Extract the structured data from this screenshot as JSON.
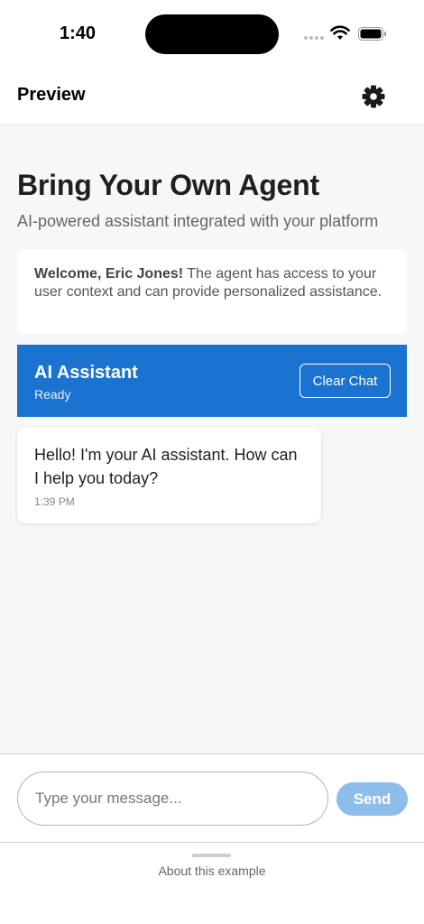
{
  "status_bar": {
    "time": "1:40",
    "icons": [
      "signal-icon",
      "wifi-icon",
      "battery-icon"
    ]
  },
  "header": {
    "title": "Preview",
    "settings_icon": "gear-icon"
  },
  "main": {
    "title": "Bring Your Own Agent",
    "subtitle": "AI-powered assistant integrated with your platform",
    "welcome": {
      "greeting": "Welcome, Eric Jones!",
      "text": " The agent has access to your user context and can provide personalized assistance."
    }
  },
  "assistant": {
    "name": "AI Assistant",
    "status": "Ready",
    "clear_label": "Clear Chat"
  },
  "messages": [
    {
      "text": "Hello! I'm your AI assistant. How can I help you today?",
      "time": "1:39 PM"
    }
  ],
  "composer": {
    "placeholder": "Type your message...",
    "value": "",
    "send_label": "Send"
  },
  "footer": {
    "label": "About this example"
  },
  "colors": {
    "accent": "#1a73d0",
    "send_disabled": "#8fbde9",
    "background": "#f7f7f7"
  }
}
